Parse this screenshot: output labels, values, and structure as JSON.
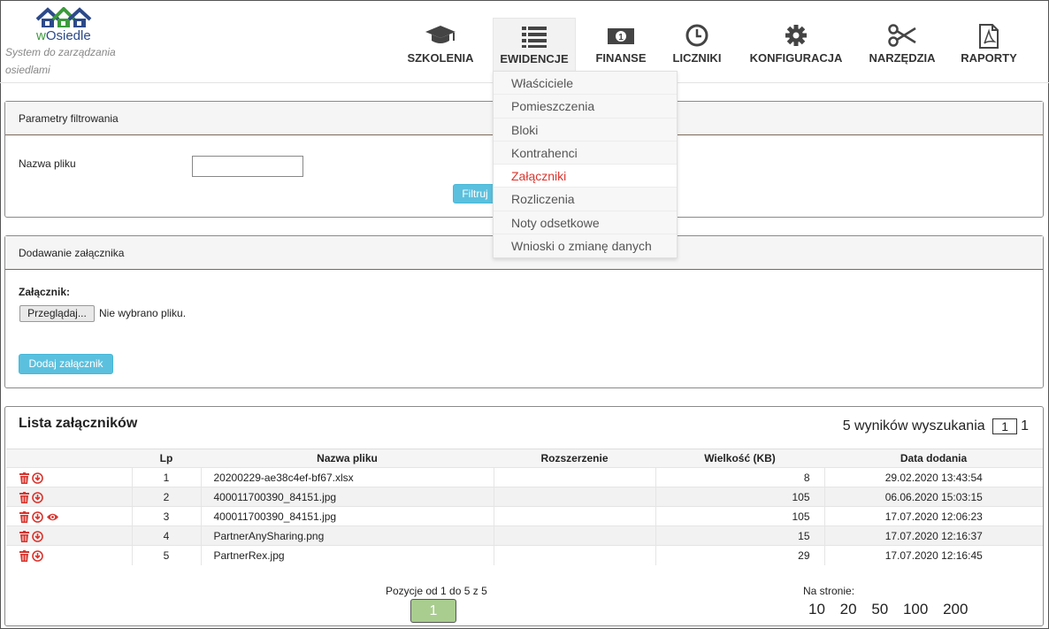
{
  "logo": {
    "text_w": "w",
    "text_rest": "Osiedle",
    "tagline": "System do zarządzania osiedlami"
  },
  "nav": [
    {
      "label": "SZKOLENIA",
      "icon": "graduation-cap-icon"
    },
    {
      "label": "EWIDENCJE",
      "icon": "list-icon"
    },
    {
      "label": "FINANSE",
      "icon": "money-icon"
    },
    {
      "label": "LICZNIKI",
      "icon": "clock-icon"
    },
    {
      "label": "KONFIGURACJA",
      "icon": "gear-icon"
    },
    {
      "label": "NARZĘDZIA",
      "icon": "scissors-icon"
    },
    {
      "label": "RAPORTY",
      "icon": "pdf-icon"
    }
  ],
  "dropdown": [
    "Właściciele",
    "Pomieszczenia",
    "Bloki",
    "Kontrahenci",
    "Załączniki",
    "Rozliczenia",
    "Noty odsetkowe",
    "Wnioski o zmianę danych"
  ],
  "filter": {
    "title": "Parametry filtrowania",
    "field_label": "Nazwa pliku",
    "field_value": "",
    "button": "Filtruj"
  },
  "add": {
    "title": "Dodawanie załącznika",
    "label": "Załącznik:",
    "browse": "Przeglądaj...",
    "no_file": "Nie wybrano pliku.",
    "button": "Dodaj załącznik"
  },
  "list": {
    "title": "Lista załączników",
    "results_text": "5 wyników wyszukania",
    "page_current": "1",
    "page_total": "1",
    "columns": [
      "Lp",
      "Nazwa pliku",
      "Rozszerzenie",
      "Wielkość (KB)",
      "Data dodania"
    ],
    "rows": [
      {
        "lp": "1",
        "name": "20200229-ae38c4ef-bf67.xlsx",
        "ext": "",
        "size": "8",
        "date": "29.02.2020 13:43:54",
        "preview": false
      },
      {
        "lp": "2",
        "name": "400011700390_84151.jpg",
        "ext": "",
        "size": "105",
        "date": "06.06.2020 15:03:15",
        "preview": false
      },
      {
        "lp": "3",
        "name": "400011700390_84151.jpg",
        "ext": "",
        "size": "105",
        "date": "17.07.2020 12:06:23",
        "preview": true
      },
      {
        "lp": "4",
        "name": "PartnerAnySharing.png",
        "ext": "",
        "size": "15",
        "date": "17.07.2020 12:16:37",
        "preview": false
      },
      {
        "lp": "5",
        "name": "PartnerRex.jpg",
        "ext": "",
        "size": "29",
        "date": "17.07.2020 12:16:45",
        "preview": false
      }
    ],
    "position_text": "Pozycje od 1 do 5 z 5",
    "page_button": "1",
    "per_page_label": "Na stronie:",
    "per_page_options": [
      "10",
      "20",
      "50",
      "100",
      "200"
    ]
  },
  "colors": {
    "accent_red": "#d9352e",
    "info_blue": "#5bc0de",
    "page_green": "#a9cd8e"
  }
}
